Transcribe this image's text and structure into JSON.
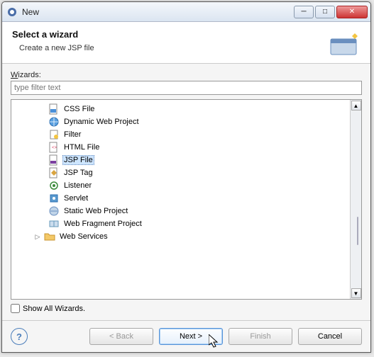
{
  "window": {
    "title": "New"
  },
  "banner": {
    "title": "Select a wizard",
    "desc": "Create a new JSP file"
  },
  "wizards_label": "Wizards:",
  "filter": {
    "placeholder": "type filter text",
    "value": ""
  },
  "tree": {
    "selected_index": 4,
    "items": [
      {
        "label": "CSS File",
        "icon": "css-file-icon"
      },
      {
        "label": "Dynamic Web Project",
        "icon": "web-project-icon"
      },
      {
        "label": "Filter",
        "icon": "filter-icon"
      },
      {
        "label": "HTML File",
        "icon": "html-file-icon"
      },
      {
        "label": "JSP File",
        "icon": "jsp-file-icon"
      },
      {
        "label": "JSP Tag",
        "icon": "jsp-tag-icon"
      },
      {
        "label": "Listener",
        "icon": "listener-icon"
      },
      {
        "label": "Servlet",
        "icon": "servlet-icon"
      },
      {
        "label": "Static Web Project",
        "icon": "static-web-icon"
      },
      {
        "label": "Web Fragment Project",
        "icon": "fragment-icon"
      }
    ],
    "folder": {
      "label": "Web Services",
      "icon": "folder-icon",
      "expanded": false
    }
  },
  "show_all": {
    "label": "Show All Wizards.",
    "checked": false
  },
  "buttons": {
    "back": "< Back",
    "next": "Next >",
    "finish": "Finish",
    "cancel": "Cancel"
  }
}
